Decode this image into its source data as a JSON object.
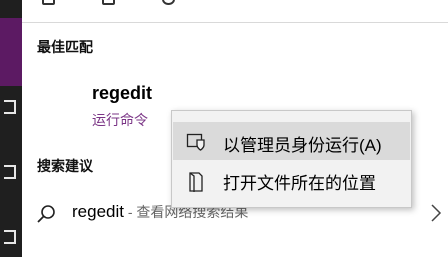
{
  "best_match": {
    "heading": "最佳匹配",
    "title": "regedit",
    "subtitle": "运行命令"
  },
  "suggestions": {
    "heading": "搜索建议",
    "item_text": "regedit",
    "item_desc": " - 查看网络搜索结果"
  },
  "context_menu": {
    "items": [
      {
        "label": "以管理员身份运行(A)",
        "icon": "shield-icon"
      },
      {
        "label": "打开文件所在的位置",
        "icon": "file-icon"
      }
    ]
  },
  "colors": {
    "accent": "#5c1a63",
    "subtitle": "#7a3485",
    "menu_bg": "#f2f2f2",
    "menu_highlight": "#dadada"
  }
}
